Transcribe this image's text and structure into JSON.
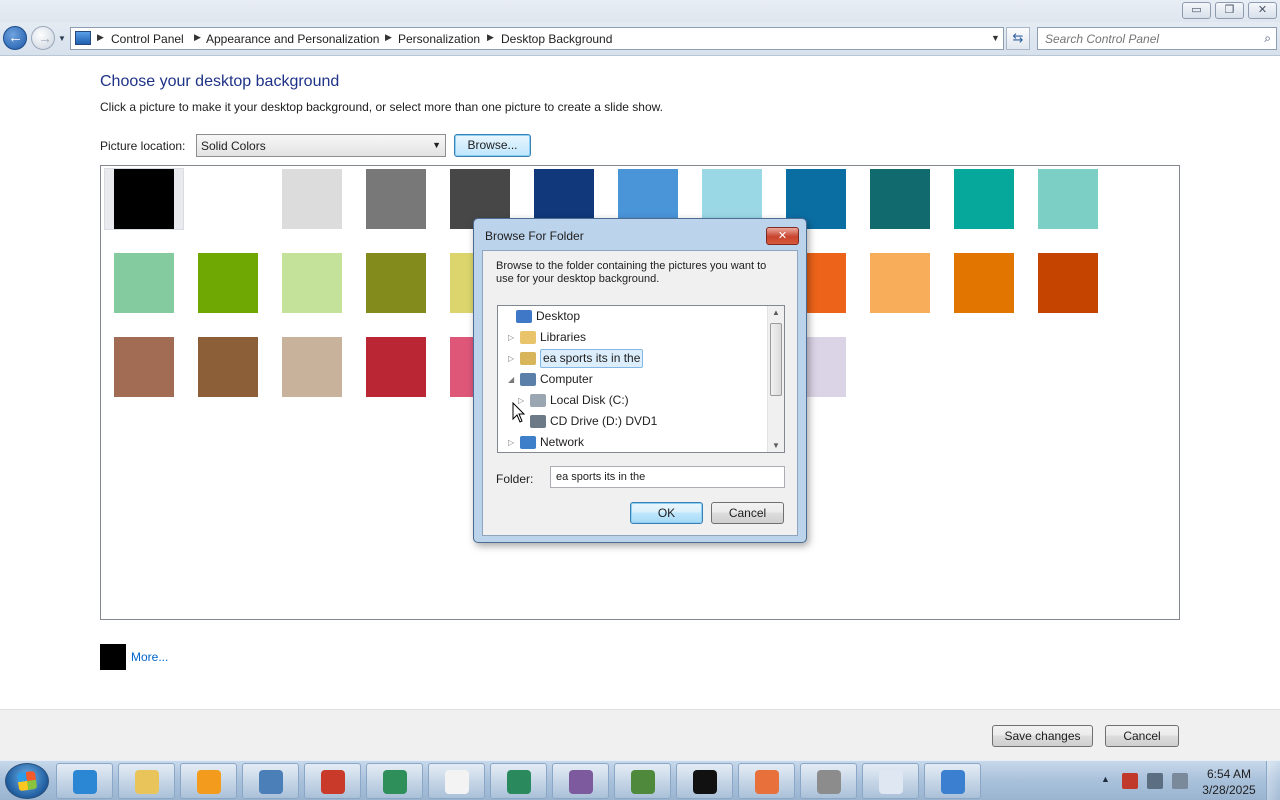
{
  "window": {
    "caption_min": "▭",
    "caption_max": "❐",
    "caption_close": "✕"
  },
  "address": {
    "breadcrumbs": [
      "Control Panel",
      "Appearance and Personalization",
      "Personalization",
      "Desktop Background"
    ],
    "search_placeholder": "Search Control Panel"
  },
  "content": {
    "title": "Choose your desktop background",
    "subtitle": "Click a picture to make it your desktop background, or select more than one picture to create a slide show.",
    "picture_location_label": "Picture location:",
    "picture_location_value": "Solid Colors",
    "browse_label": "Browse...",
    "more_label": "More...",
    "more_color": "#000000",
    "swatch_rows": [
      [
        "#000000",
        "#ffffff",
        "#dcdcdc",
        "#787878",
        "#474747",
        "#10387a",
        "#4a94d8",
        "#9ad8e6",
        "#0b6ea3",
        "#116b6e",
        "#06a89b",
        "#7ccfc4"
      ],
      [
        "#84cca0",
        "#70a803",
        "#c5e29a",
        "#838b1d",
        "#dcd56e",
        "#f1c100",
        "#f9b600",
        "#f6c7aa",
        "#ec6319",
        "#f8ad5a",
        "#e17500",
        "#c44400"
      ],
      [
        "#a26b53",
        "#8c5f38",
        "#c9b29b",
        "#bb2634",
        "#de5779",
        "#d1abc5",
        "#c95aa2",
        "#9b3a8c",
        "#dbd3e6"
      ]
    ],
    "selected_swatch": "#000000"
  },
  "footer": {
    "save_label": "Save changes",
    "cancel_label": "Cancel"
  },
  "dialog": {
    "title": "Browse For Folder",
    "close_glyph": "✕",
    "instructions": "Browse to the folder containing the pictures you want to use for your desktop background.",
    "tree": [
      {
        "label": "Desktop",
        "expander": "",
        "icon_color": "#3f78c7",
        "selected": false
      },
      {
        "label": "Libraries",
        "expander": "▷",
        "icon_color": "#e9c46a",
        "selected": false
      },
      {
        "label": "ea sports its in the",
        "expander": "▷",
        "icon_color": "#d8b45a",
        "selected": true
      },
      {
        "label": "Computer",
        "expander": "◢",
        "icon_color": "#5a7fa8",
        "selected": false
      },
      {
        "label": "Local Disk (C:)",
        "expander": "▷",
        "icon_color": "#9aa6b2",
        "selected": false
      },
      {
        "label": "CD Drive (D:) DVD1",
        "expander": "",
        "icon_color": "#6b7a86",
        "selected": false
      },
      {
        "label": "Network",
        "expander": "▷",
        "icon_color": "#3d7fc8",
        "selected": false
      }
    ],
    "folder_label": "Folder:",
    "folder_value": "ea sports its in the",
    "ok_label": "OK",
    "cancel_label": "Cancel"
  },
  "taskbar": {
    "items": [
      {
        "name": "internet-explorer-icon",
        "color": "#2b86d4"
      },
      {
        "name": "windows-explorer-icon",
        "color": "#e8c45a"
      },
      {
        "name": "media-player-icon",
        "color": "#f29b1d"
      },
      {
        "name": "remote-desktop-icon",
        "color": "#4a7fb8"
      },
      {
        "name": "toolbox-icon",
        "color": "#c93a2a"
      },
      {
        "name": "globe-icon",
        "color": "#2f8f5b"
      },
      {
        "name": "notepad-icon",
        "color": "#f3f3f3"
      },
      {
        "name": "network-globe-icon",
        "color": "#2a8a5e"
      },
      {
        "name": "security-icon",
        "color": "#7d5a9e"
      },
      {
        "name": "circuit-board-icon",
        "color": "#4f8a3c"
      },
      {
        "name": "command-prompt-icon",
        "color": "#111111"
      },
      {
        "name": "paint-icon",
        "color": "#e8703a"
      },
      {
        "name": "tools-icon",
        "color": "#8c8c8c"
      },
      {
        "name": "document-icon",
        "color": "#dfe8f2"
      },
      {
        "name": "control-panel-icon",
        "color": "#3a7fd0"
      }
    ],
    "time": "6:54 AM",
    "date": "3/28/2025"
  }
}
